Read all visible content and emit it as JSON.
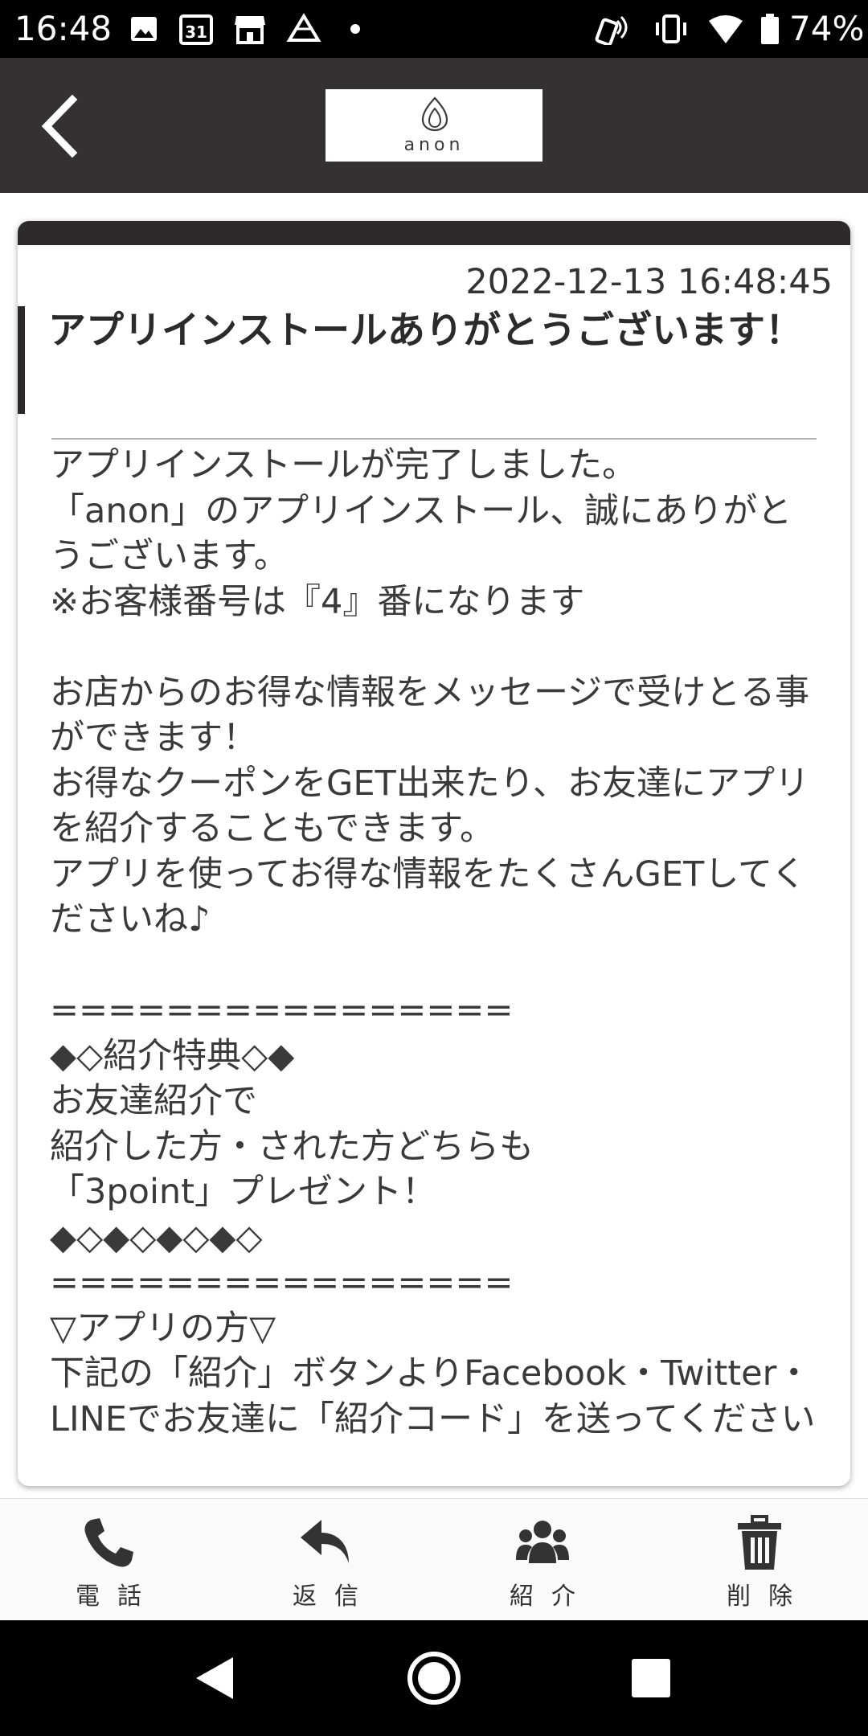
{
  "status_bar": {
    "time": "16:48",
    "battery_percent": "74%",
    "calendar_day": "31",
    "icons": [
      "image-icon",
      "calendar-icon",
      "store-icon",
      "drive-icon",
      "dot-icon",
      "nfc-icon",
      "vibrate-icon",
      "wifi-icon",
      "battery-icon"
    ]
  },
  "header": {
    "back_icon": "chevron-left-icon",
    "logo_text": "anon"
  },
  "message": {
    "date": "2022-12-13 16:48:45",
    "title": "アプリインストールありがとうございます！",
    "body": "アプリインストールが完了しました。\n「anon」のアプリインストール、誠にありがとうございます。\n※お客様番号は『4』番になります\n\nお店からのお得な情報をメッセージで受けとる事ができます！\nお得なクーポンをGET出来たり、お友達にアプリを紹介することもできます。\nアプリを使ってお得な情報をたくさんGETしてくださいね♪\n\n================\n◆◇紹介特典◇◆\nお友達紹介で\n紹介した方・された方どちらも\n「3point」プレゼント！\n◆◇◆◇◆◇◆◇\n================\n▽アプリの方▽\n下記の「紹介」ボタンよりFacebook・Twitter・LINEでお友達に「紹介コード」を送ってください"
  },
  "toolbar": {
    "buttons": [
      {
        "label": "電話",
        "icon": "phone-icon"
      },
      {
        "label": "返信",
        "icon": "reply-icon"
      },
      {
        "label": "紹介",
        "icon": "users-icon"
      },
      {
        "label": "削除",
        "icon": "trash-icon"
      }
    ]
  },
  "nav_bar": {
    "icons": [
      "back-triangle-icon",
      "home-circle-icon",
      "recents-square-icon"
    ]
  },
  "colors": {
    "header_bg": "#333132",
    "card_accent": "#2c2a2b",
    "status_bar_bg": "#000000",
    "text": "#3a3a3a"
  }
}
